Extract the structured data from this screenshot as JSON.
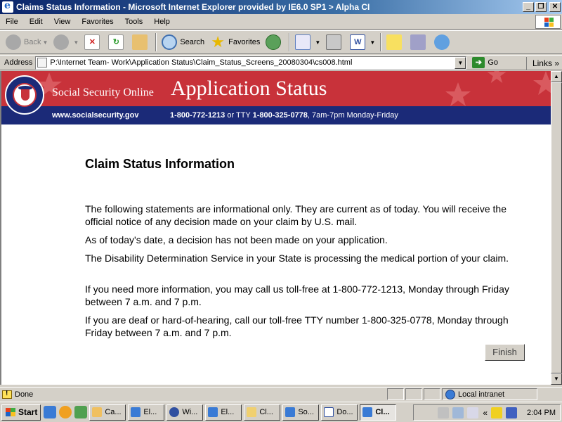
{
  "window": {
    "title": "Claims Status Information - Microsoft Internet Explorer provided by IE6.0 SP1 > Alpha CI",
    "controls": {
      "minimize": "_",
      "maximize": "❐",
      "close": "✕"
    }
  },
  "menu": [
    "File",
    "Edit",
    "View",
    "Favorites",
    "Tools",
    "Help"
  ],
  "toolbar": {
    "back_label": "Back",
    "search_label": "Search",
    "favorites_label": "Favorites"
  },
  "address": {
    "label": "Address",
    "value": "P:\\Internet Team- Work\\Application Status\\Claim_Status_Screens_20080304\\cs008.html",
    "go_label": "Go",
    "links_label": "Links"
  },
  "banner": {
    "brand": "Social Security Online",
    "title": "Application Status",
    "url": "www.socialsecurity.gov",
    "phone": "1-800-772-1213",
    "tty_label": " or TTY ",
    "tty_number": "1-800-325-0778",
    "hours": ", 7am-7pm Monday-Friday",
    "seal_text": "SOCIAL SECURITY ADMINISTRATION USA",
    "colors": {
      "red": "#c8323a",
      "blue": "#1b2a78"
    }
  },
  "page": {
    "heading": "Claim Status Information",
    "paragraphs": [
      "The following statements are informational only. They are current as of today. You will receive the official notice of any decision made on your claim by U.S. mail.",
      "As of today's date, a decision has not been made on your application.",
      "The Disability Determination Service in your State is processing the medical portion of your claim.",
      "If you need more information, you may call us toll-free at 1-800-772-1213, Monday through Friday between 7 a.m. and 7 p.m.",
      "If you are deaf or hard-of-hearing, call our toll-free TTY number 1-800-325-0778, Monday through Friday between 7 a.m. and 7 p.m."
    ],
    "finish_label": "Finish"
  },
  "status": {
    "text": "Done",
    "zone": "Local intranet"
  },
  "taskbar": {
    "start_label": "Start",
    "buttons": [
      "Ca...",
      "El...",
      "Wi...",
      "El...",
      "Cl...",
      "So...",
      "Do...",
      "Cl..."
    ],
    "tray_chevron": "«",
    "clock": "2:04 PM"
  }
}
